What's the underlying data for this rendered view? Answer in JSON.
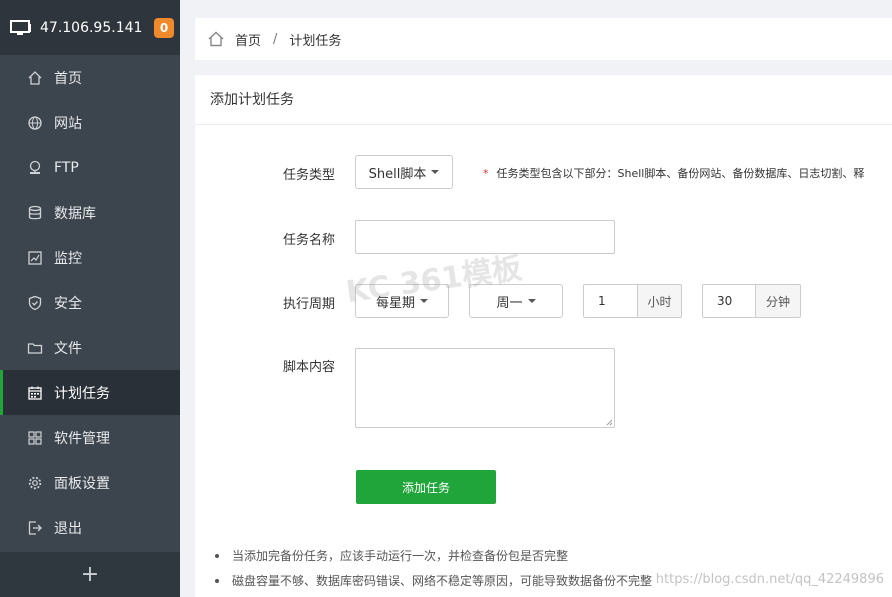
{
  "sidebar": {
    "server_ip": "47.106.95.141",
    "badge_count": "0",
    "items": [
      {
        "label": "首页",
        "icon": "home-icon"
      },
      {
        "label": "网站",
        "icon": "globe-icon"
      },
      {
        "label": "FTP",
        "icon": "ftp-icon"
      },
      {
        "label": "数据库",
        "icon": "database-icon"
      },
      {
        "label": "监控",
        "icon": "monitor-chart-icon"
      },
      {
        "label": "安全",
        "icon": "shield-icon"
      },
      {
        "label": "文件",
        "icon": "folder-icon"
      },
      {
        "label": "计划任务",
        "icon": "calendar-icon",
        "active": true
      },
      {
        "label": "软件管理",
        "icon": "grid-icon"
      },
      {
        "label": "面板设置",
        "icon": "gear-icon"
      },
      {
        "label": "退出",
        "icon": "logout-icon"
      }
    ],
    "plus_label": "+"
  },
  "breadcrumb": {
    "home": "首页",
    "separator": "/",
    "current": "计划任务"
  },
  "panel": {
    "title": "添加计划任务",
    "task_type": {
      "label": "任务类型",
      "value": "Shell脚本",
      "hint_star": "*",
      "hint": "任务类型包含以下部分：Shell脚本、备份网站、备份数据库、日志切割、释"
    },
    "task_name": {
      "label": "任务名称",
      "value": ""
    },
    "cycle": {
      "label": "执行周期",
      "period": "每星期",
      "weekday": "周一",
      "hour_value": "1",
      "hour_unit": "小时",
      "minute_value": "30",
      "minute_unit": "分钟"
    },
    "script": {
      "label": "脚本内容",
      "value": ""
    },
    "submit_label": "添加任务",
    "notes": [
      "当添加完备份任务，应该手动运行一次，并检查备份包是否完整",
      "磁盘容量不够、数据库密码错误、网络不稳定等原因，可能导致数据备份不完整"
    ]
  },
  "watermarks": {
    "center": "KC 361模板",
    "corner": "https://blog.csdn.net/qq_42249896"
  },
  "colors": {
    "accent": "#20a53a",
    "sidebar_bg": "#3c444d",
    "badge": "#f0882c"
  }
}
